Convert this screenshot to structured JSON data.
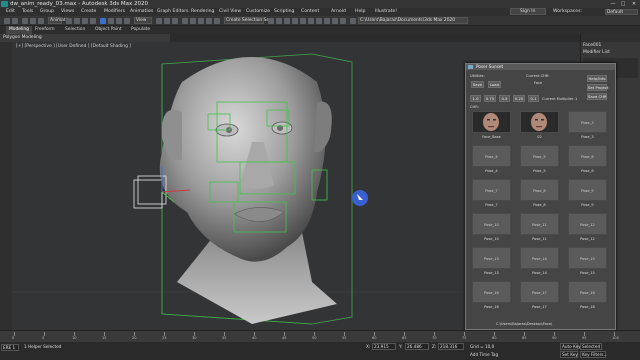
{
  "window": {
    "title": "dw_anim_ready_03.max - Autodesk 3ds Max 2020",
    "controls": [
      "—",
      "□",
      "✕"
    ]
  },
  "menu": {
    "items": [
      "Edit",
      "Tools",
      "Group",
      "Views",
      "Create",
      "Modifiers",
      "Animation",
      "Graph Editors",
      "Rendering",
      "Civil View",
      "Customize",
      "Scripting",
      "Content",
      "Arnold",
      "Help",
      "Illustrate!"
    ],
    "sign_in": "Sign In",
    "workspaces_label": "Workspaces:",
    "workspace_value": "Default"
  },
  "toolbar": {
    "view_select": "View",
    "selection_set": "Create Selection Se",
    "path": "C:\\Users\\Bajaras\\Documents\\3ds Max 2020"
  },
  "ribbon": {
    "tabs": [
      "Modeling",
      "Freeform",
      "Selection",
      "Object Paint",
      "Populate"
    ],
    "sub_label": "Polygon Modeling"
  },
  "viewport": {
    "label": "[+] [Perspective ] [User Defined ] [Default Shading ]"
  },
  "right_panel": {
    "items": [
      "Face001",
      "Modifier List",
      "",
      "",
      "",
      ""
    ]
  },
  "poser": {
    "title": "Poser Sunset",
    "utilities_label": "Utilities:",
    "save_label": "Save",
    "load_label": "Load",
    "current_cha_label": "Current CHR:",
    "current_cha_value": "Face",
    "help_label": "Help/Info",
    "set_project_label": "Set Project",
    "save_chr_label": "Save CHR",
    "multipliers": [
      "1.0",
      "0.75",
      "0.5",
      "0.25",
      "0.1"
    ],
    "current_multiplier_label": "Current Multiplier:",
    "current_multiplier_value": "1",
    "chr_label": "CHR:",
    "slots": [
      {
        "name": "Face_Base",
        "thumb": true
      },
      {
        "name": "02",
        "thumb": true
      },
      {
        "name": "Pose_3",
        "thumb": false
      },
      {
        "name": "Pose_4",
        "thumb": false
      },
      {
        "name": "Pose_5",
        "thumb": false
      },
      {
        "name": "Pose_6",
        "thumb": false
      },
      {
        "name": "Pose_7",
        "thumb": false
      },
      {
        "name": "Pose_8",
        "thumb": false
      },
      {
        "name": "Pose_9",
        "thumb": false
      },
      {
        "name": "Pose_10",
        "thumb": false
      },
      {
        "name": "Pose_11",
        "thumb": false
      },
      {
        "name": "Pose_12",
        "thumb": false
      },
      {
        "name": "Pose_13",
        "thumb": false
      },
      {
        "name": "Pose_14",
        "thumb": false
      },
      {
        "name": "Pose_15",
        "thumb": false
      },
      {
        "name": "Pose_16",
        "thumb": false
      },
      {
        "name": "Pose_17",
        "thumb": false
      },
      {
        "name": "Pose_18",
        "thumb": false
      }
    ],
    "footer_path": "C:\\Users\\Bajaras\\Desktop\\Face\\"
  },
  "timeline": {
    "ticks": [
      "0",
      "5",
      "10",
      "15",
      "20",
      "25",
      "30",
      "35",
      "40",
      "45",
      "50",
      "55",
      "60",
      "65",
      "70",
      "75",
      "80",
      "85",
      "90",
      "95",
      "100"
    ]
  },
  "status": {
    "script_field": "ERE 1",
    "selection_text": "1 Helper Selected",
    "x_label": "X:",
    "x_value": "23.915",
    "y_label": "Y:",
    "y_value": "26.486",
    "z_label": "Z:",
    "z_value": "218.316",
    "grid_text": "Grid = 10,0",
    "add_time_tag": "Add Time Tag",
    "auto_key": "Auto Key",
    "selected": "Selected",
    "set_key": "Set Key",
    "key_filters": "Key Filters..."
  },
  "colors": {
    "accent_blue": "#3a6fd0",
    "bone_green": "#43c24a",
    "wire_red": "#cc3a3a"
  }
}
